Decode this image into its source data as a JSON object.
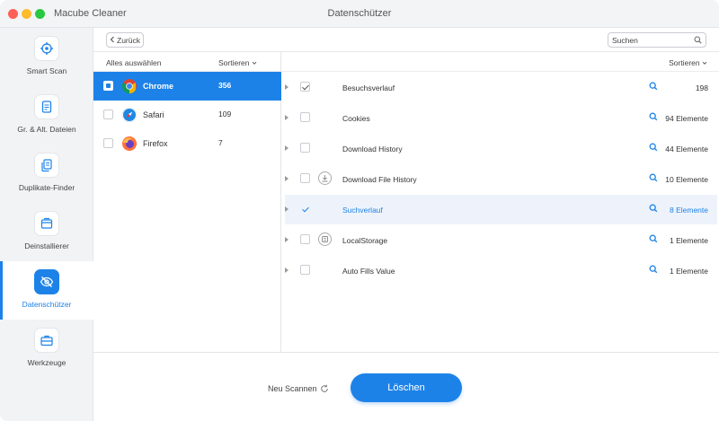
{
  "window": {
    "app_title": "Macube Cleaner",
    "title": "Datenschützer"
  },
  "sidebar": {
    "items": [
      {
        "label": "Smart Scan",
        "icon": "target-icon",
        "active": false
      },
      {
        "label": "Gr. & Alt. Dateien",
        "icon": "file-icon",
        "active": false
      },
      {
        "label": "Duplikate-Finder",
        "icon": "duplicate-icon",
        "active": false
      },
      {
        "label": "Deinstallierer",
        "icon": "uninstall-icon",
        "active": false
      },
      {
        "label": "Datenschützer",
        "icon": "eye-off-icon",
        "active": true
      },
      {
        "label": "Werkzeuge",
        "icon": "toolbox-icon",
        "active": false
      }
    ]
  },
  "toolbar": {
    "back_label": "Zurück",
    "search_placeholder": "Suchen"
  },
  "browsers": {
    "select_all_label": "Alles auswählen",
    "sort_label": "Sortieren",
    "items": [
      {
        "name": "Chrome",
        "count": "356",
        "icon": "chrome-icon",
        "active": true
      },
      {
        "name": "Safari",
        "count": "109",
        "icon": "safari-icon",
        "active": false
      },
      {
        "name": "Firefox",
        "count": "7",
        "icon": "firefox-icon",
        "active": false
      }
    ]
  },
  "details": {
    "sort_label": "Sortieren",
    "items": [
      {
        "name": "Besuchsverlauf",
        "count": "198",
        "checked": true,
        "active": false,
        "icon": ""
      },
      {
        "name": "Cookies",
        "count": "94 Elemente",
        "checked": false,
        "active": false,
        "icon": ""
      },
      {
        "name": "Download History",
        "count": "44 Elemente",
        "checked": false,
        "active": false,
        "icon": ""
      },
      {
        "name": "Download File History",
        "count": "10 Elemente",
        "checked": false,
        "active": false,
        "icon": "download-icon"
      },
      {
        "name": "Suchverlauf",
        "count": "8 Elemente",
        "checked": true,
        "active": true,
        "icon": ""
      },
      {
        "name": "LocalStorage",
        "count": "1 Elemente",
        "checked": false,
        "active": false,
        "icon": "storage-icon"
      },
      {
        "name": "Auto Fills Value",
        "count": "1 Elemente",
        "checked": false,
        "active": false,
        "icon": ""
      }
    ]
  },
  "footer": {
    "rescan_label": "Neu Scannen",
    "delete_label": "Löschen"
  },
  "colors": {
    "accent": "#1d82e8",
    "sidebar_bg": "#f2f3f5",
    "active_row_bg": "#eef3fb"
  }
}
